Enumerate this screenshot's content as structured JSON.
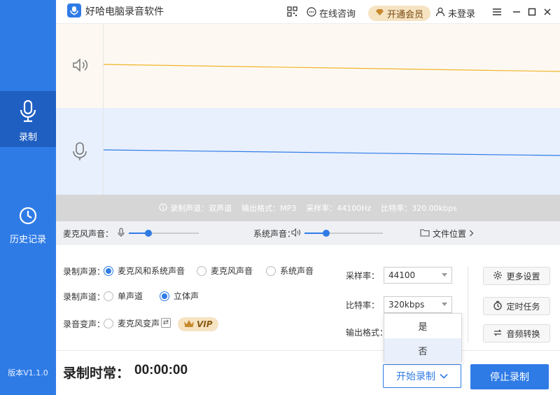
{
  "app": {
    "title": "好哈电脑录音软件"
  },
  "titlebar": {
    "consult_label": "在线咨询",
    "vip_label": "开通会员",
    "login_label": "未登录"
  },
  "sidebar": {
    "items": [
      {
        "label": "录制",
        "icon": "microphone-icon",
        "active": true
      },
      {
        "label": "历史记录",
        "icon": "clock-icon",
        "active": false
      }
    ],
    "version": "版本V1.1.0"
  },
  "waveform": {
    "system_line_color": "#f0b429",
    "mic_line_color": "#2f7be6"
  },
  "info_bar": {
    "channel": "录制声道：双声道",
    "format": "输出格式：MP3",
    "sample_rate": "采样率：44100Hz",
    "bit_rate": "比特率：320.00kbps"
  },
  "volume": {
    "mic_label": "麦克风声音：",
    "mic_level": 0.28,
    "system_label": "系统声音：",
    "system_level": 0.28,
    "file_location_label": "文件位置"
  },
  "settings": {
    "source_label": "录制声源：",
    "source_options": [
      "麦克风和系统声音",
      "麦克风声音",
      "系统声音"
    ],
    "source_selected": 0,
    "channel_label": "录制声道：",
    "channel_options": [
      "单声道",
      "立体声"
    ],
    "channel_selected": 1,
    "voice_change_label": "录音变声：",
    "voice_change_option": "麦克风变声",
    "vip_badge": "VIP",
    "sample_rate_label": "采样率：",
    "sample_rate_value": "44100",
    "bit_rate_label": "比特率：",
    "bit_rate_value": "320kbps",
    "output_format_label": "输出格式：",
    "dropdown_options": [
      "是",
      "否"
    ],
    "dropdown_highlight": 1,
    "buttons": {
      "more_settings": "更多设置",
      "scheduled_task": "定时任务",
      "audio_convert": "音频转换"
    }
  },
  "bottom": {
    "time_label": "录制时常：",
    "time_value": "00:00:00",
    "start_label": "开始录制",
    "stop_label": "停止录制"
  },
  "colors": {
    "accent": "#2f7be6",
    "sidebar_active": "#1f5fc2",
    "vip_gold": "#f6e3c2"
  }
}
